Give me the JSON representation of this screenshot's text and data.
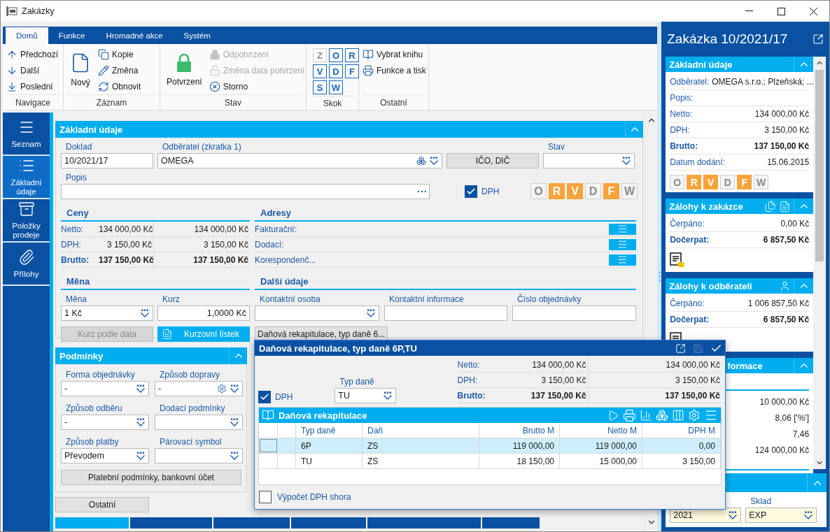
{
  "window": {
    "title": "Zakázky"
  },
  "ribbon": {
    "tabs": [
      {
        "label": "Domů",
        "selected": true
      },
      {
        "label": "Funkce",
        "selected": false
      },
      {
        "label": "Hromadné akce",
        "selected": false
      },
      {
        "label": "Systém",
        "selected": false
      }
    ],
    "groups": [
      {
        "kind": "list",
        "label": "Navigace",
        "items": [
          {
            "label": "Předchozí",
            "disabled": false
          },
          {
            "label": "Další",
            "disabled": false
          },
          {
            "label": "Poslední",
            "disabled": false
          }
        ]
      },
      {
        "kind": "list",
        "label": "Záznam",
        "large": {
          "label": "Nový"
        },
        "items": [
          {
            "label": "Kopie",
            "disabled": false
          },
          {
            "label": "Změna",
            "disabled": false
          },
          {
            "label": "Obnovit",
            "disabled": false
          }
        ]
      },
      {
        "kind": "list",
        "label": "Stav",
        "large": {
          "label": "Potvrzení"
        },
        "items": [
          {
            "label": "Odpotvrzení",
            "disabled": true
          },
          {
            "label": "Změna data potvrzení",
            "disabled": true
          },
          {
            "label": "Storno",
            "disabled": false
          }
        ]
      },
      {
        "kind": "keys",
        "label": "Skok",
        "items": [
          {
            "label": "Z",
            "disabled": true
          },
          {
            "label": "O",
            "disabled": false
          },
          {
            "label": "R",
            "disabled": false
          },
          {
            "label": "V",
            "disabled": false
          },
          {
            "label": "D",
            "disabled": false
          },
          {
            "label": "F",
            "disabled": false
          },
          {
            "label": "S",
            "disabled": false
          },
          {
            "label": "W",
            "disabled": false
          }
        ]
      },
      {
        "kind": "list",
        "label": "Ostatní",
        "items": [
          {
            "label": "Vybrat knihu",
            "disabled": false
          },
          {
            "label": "Funkce a tisk",
            "disabled": false
          }
        ]
      }
    ]
  },
  "side_nav": [
    {
      "label": "Seznam",
      "selected": false
    },
    {
      "label": "Základní údaje",
      "selected": true
    },
    {
      "label": "Položky prodeje",
      "selected": false
    },
    {
      "label": "Přílohy",
      "selected": false
    }
  ],
  "main_panel": {
    "title": "Základní údaje",
    "doklad": {
      "label": "Doklad",
      "value": "10/2021/17"
    },
    "odberatel": {
      "label": "Odběratel (zkratka 1)",
      "value": "OMEGA"
    },
    "ico_button": "IČO, DIČ",
    "stav": {
      "label": "Stav"
    },
    "popis": {
      "label": "Popis"
    },
    "dph": {
      "label": "DPH",
      "checked": true
    },
    "status_keys": [
      {
        "label": "O",
        "active": false
      },
      {
        "label": "R",
        "active": true
      },
      {
        "label": "V",
        "active": true
      },
      {
        "label": "D",
        "active": false
      },
      {
        "label": "F",
        "active": true
      },
      {
        "label": "W",
        "active": false
      }
    ],
    "ceny": {
      "title": "Ceny",
      "rows": [
        {
          "label": "Netto:",
          "value_1": "134 000,00 Kč",
          "value_2": "134 000,00 Kč",
          "emphasis": false
        },
        {
          "label": "DPH:",
          "value_1": "3 150,00 Kč",
          "value_2": "3 150,00 Kč",
          "emphasis": false
        },
        {
          "label": "Brutto:",
          "value_1": "137 150,00 Kč",
          "value_2": "137 150,00 Kč",
          "emphasis": true
        }
      ]
    },
    "adresy": {
      "title": "Adresy",
      "rows": [
        "Fakturační:",
        "Dodací:",
        "Korespondenč..."
      ]
    },
    "mena": {
      "title": "Měna",
      "currency": {
        "label": "Měna",
        "value": "1 Kč"
      },
      "rate": {
        "label": "Kurz",
        "value": "1,0000 Kč"
      },
      "rate_by_date": {
        "label": "Kurz podle data",
        "disabled": true
      },
      "rate_sheet": "Kurzovní lístek"
    },
    "dalsi_udaje": {
      "title": "Další údaje",
      "fields": [
        {
          "label": "Kontaktní osoba",
          "kind": "dropdown"
        },
        {
          "label": "Kontaktní informace",
          "kind": "text"
        },
        {
          "label": "Číslo objednávky",
          "kind": "text"
        }
      ],
      "button": "Daňová rekapitulace, typ daně 6..."
    }
  },
  "podminky": {
    "title": "Podmínky",
    "fields": [
      {
        "label": "Forma objednávky",
        "value": "-",
        "kind": "dropdown"
      },
      {
        "label": "Způsob dopravy",
        "value": "-",
        "kind": "dropdown-gear"
      },
      {
        "label": "Způsob odběru",
        "value": "-",
        "kind": "dropdown"
      },
      {
        "label": "Dodací podmínky",
        "kind": "dropdown"
      },
      {
        "label": "Způsob platby",
        "value": "Převodem",
        "kind": "dropdown"
      },
      {
        "label": "Párovací symbol",
        "kind": "dropdown"
      }
    ],
    "button": "Platební podmínky, bankovní účet"
  },
  "other_button": "Ostatní",
  "bottom_tabs": [
    {
      "selected": true
    },
    {
      "selected": false
    },
    {
      "selected": false
    },
    {
      "selected": false
    },
    {
      "selected": false
    },
    {
      "selected": false
    }
  ],
  "popup": {
    "title": "Daňová rekapitulace, typ daně 6P,TU",
    "dph": {
      "label": "DPH",
      "checked": true
    },
    "typ_dane": {
      "label": "Typ daně",
      "value": "TU"
    },
    "sums": [
      {
        "label": "Netto:",
        "value_1": "134 000,00 Kč",
        "value_2": "134 000,00 Kč",
        "emphasis": false
      },
      {
        "label": "DPH:",
        "value_1": "3 150,00 Kč",
        "value_2": "3 150,00 Kč",
        "emphasis": false
      },
      {
        "label": "Brutto:",
        "value_1": "137 150,00 Kč",
        "value_2": "137 150,00 Kč",
        "emphasis": true
      }
    ],
    "grid": {
      "title": "Daňová rekapitulace",
      "columns": [
        "Typ daně",
        "Daň",
        "Brutto M",
        "Netto M",
        "DPH M"
      ],
      "rows": [
        {
          "selected": true,
          "cells": [
            "6P",
            "ZS",
            "119 000,00",
            "119 000,00",
            "0,00"
          ]
        },
        {
          "selected": false,
          "cells": [
            "TU",
            "ZS",
            "18 150,00",
            "15 000,00",
            "3 150,00"
          ]
        }
      ]
    },
    "vypocet": {
      "label": "Výpočet DPH shora",
      "checked": false
    }
  },
  "right_panel": {
    "title": "Zakázka 10/2021/17",
    "sections": [
      {
        "title": "Základní údaje",
        "kind": "full",
        "rows": [
          {
            "kind": "inline",
            "label": "Odběratel:",
            "value": "OMEGA s.r.o.; Plzeňská; ...",
            "emphasis": false
          },
          {
            "kind": "pair",
            "label": "Popis:",
            "emphasis": false
          },
          {
            "kind": "pair",
            "label": "Netto:",
            "value": "134 000,00 Kč",
            "emphasis": false
          },
          {
            "kind": "pair",
            "label": "DPH:",
            "value": "3 150,00 Kč",
            "emphasis": false
          },
          {
            "kind": "pair",
            "label": "Brutto:",
            "value": "137 150,00 Kč",
            "emphasis": true
          },
          {
            "kind": "pair",
            "label": "Datum dodání:",
            "value": "15.06.2015",
            "emphasis": false
          }
        ],
        "status_keys": [
          {
            "label": "O",
            "active": false
          },
          {
            "label": "R",
            "active": true
          },
          {
            "label": "V",
            "active": true
          },
          {
            "label": "D",
            "active": false
          },
          {
            "label": "F",
            "active": true
          },
          {
            "label": "W",
            "active": false
          }
        ]
      },
      {
        "title": "Zálohy k zakázce",
        "kind": "full",
        "rows": [
          {
            "kind": "pair",
            "label": "Čerpáno:",
            "value": "0,00 Kč",
            "emphasis": false
          },
          {
            "kind": "pair",
            "label": "Dočerpat:",
            "value": "6 857,50 Kč",
            "emphasis": true
          }
        ]
      },
      {
        "title": "Zálohy k odběrateli",
        "kind": "full",
        "rows": [
          {
            "kind": "pair",
            "label": "Čerpáno:",
            "value": "1 006 857,50 Kč",
            "emphasis": false
          },
          {
            "kind": "pair",
            "label": "Dočerpat:",
            "value": "6 857,50 Kč",
            "emphasis": true
          }
        ]
      },
      {
        "title": "formace",
        "kind": "partial",
        "rows": [
          {
            "kind": "pair",
            "value": "10 000,00 Kč",
            "emphasis": false
          },
          {
            "kind": "pair",
            "value": "8,06 ['%']",
            "emphasis": false
          },
          {
            "kind": "pair",
            "value": "7,46",
            "emphasis": false
          },
          {
            "kind": "pair",
            "value": "124 000,00 Kč",
            "emphasis": false
          }
        ]
      }
    ],
    "bottom": {
      "fields": [
        {
          "value": "2021"
        },
        {
          "label": "Sklad",
          "value": "EXP"
        }
      ]
    }
  }
}
